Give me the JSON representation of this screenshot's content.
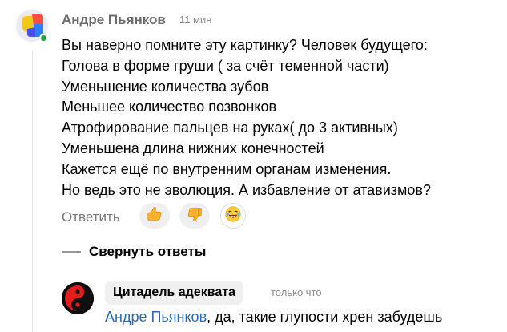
{
  "comment": {
    "author": "Андре Пьянков",
    "time": "11 мин",
    "lines": [
      "Вы наверно помните эту картинку? Человек будущего:",
      "Голова в форме груши ( за счёт теменной части)",
      "Уменьшение количества зубов",
      "Меньшее количество позвонков",
      "Атрофирование пальцев на руках( до 3 активных)",
      "Уменьшена длина нижних конечностей",
      "Кажется ещё по внутренним органам изменения.",
      "Но ведь это не эволюция. А избавление от атавизмов?"
    ],
    "reply_label": "Ответить",
    "reactions": [
      "thumbs-up-icon",
      "thumbs-down-icon",
      "laughing-face-icon"
    ]
  },
  "thread": {
    "collapse_label": "Свернуть ответы"
  },
  "reply": {
    "author": "Цитадель адеквата",
    "time": "только что",
    "mention": "Андре Пьянков",
    "text": ", да, такие глупости хрен забудешь"
  },
  "colors": {
    "mention": "#2a6ab5",
    "online": "#25a445",
    "reaction_bg": "#efefef"
  }
}
